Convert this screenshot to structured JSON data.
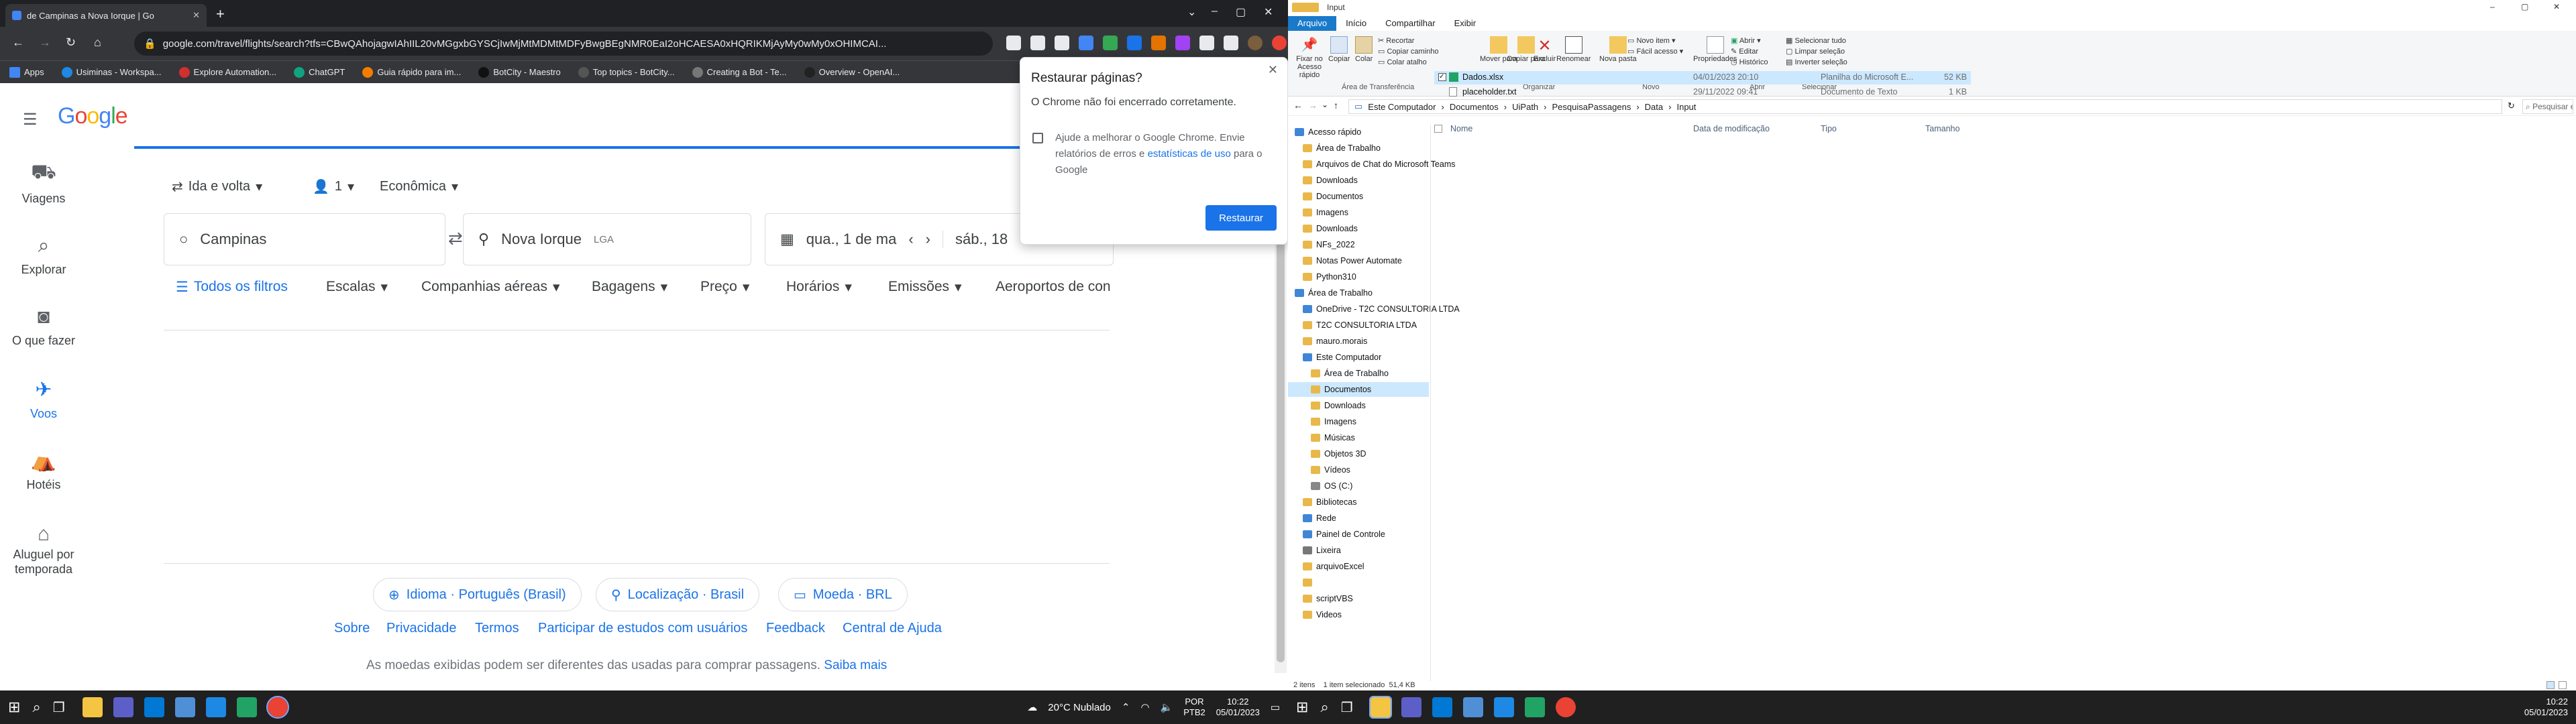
{
  "chrome": {
    "tab_title": "de Campinas a Nova Iorque | Go",
    "url": "google.com/travel/flights/search?tfs=CBwQAhojagwIAhIIL20vMGgxbGYSCjIwMjMtMDMtMDFyBwgBEgNMR0EaI2oHCAESA0xHQRIKMjAyMy0wMy0xOHIMCAI...",
    "bookmarks": [
      "Apps",
      "Usiminas - Workspa...",
      "Explore Automation...",
      "ChatGPT",
      "Guia rápido para im...",
      "BotCity - Maestro",
      "Top topics - BotCity...",
      "Creating a Bot - Te...",
      "Overview - OpenAI..."
    ]
  },
  "flights": {
    "logo": "Google",
    "nav": [
      "Viagens",
      "Explorar",
      "O que fazer",
      "Voos",
      "Hotéis",
      "Aluguel por temporada"
    ],
    "trip_type": "Ida e volta",
    "passengers": "1",
    "cabin": "Econômica",
    "origin": "Campinas",
    "destination": "Nova Iorque",
    "destination_code": "LGA",
    "depart_date": "qua., 1 de ma",
    "return_date": "sáb., 18",
    "filters": [
      "Todos os filtros",
      "Escalas",
      "Companhias aéreas",
      "Bagagens",
      "Preço",
      "Horários",
      "Emissões",
      "Aeroportos de con"
    ],
    "footer_pills": [
      "Idioma · Português (Brasil)",
      "Localização · Brasil",
      "Moeda · BRL"
    ],
    "footer_links": [
      "Sobre",
      "Privacidade",
      "Termos",
      "Participar de estudos com usuários",
      "Feedback",
      "Central de Ajuda"
    ],
    "disclaimer": "As moedas exibidas podem ser diferentes das usadas para comprar passagens.",
    "disclaimer_link": "Saiba mais"
  },
  "dialog": {
    "title": "Restaurar páginas?",
    "message": "O Chrome não foi encerrado corretamente.",
    "checkbox_text": "Ajude a melhorar o Google Chrome. Envie relatórios de erros e",
    "checkbox_link": "estatísticas de uso",
    "checkbox_tail": "para o Google",
    "button": "Restaurar"
  },
  "taskbar_left": {
    "weather": "20°C Nublado",
    "lang": "POR",
    "lang2": "PTB2",
    "time": "10:22",
    "date": "05/01/2023"
  },
  "explorer": {
    "title": "Input",
    "ribbon_tabs": [
      "Arquivo",
      "Início",
      "Compartilhar",
      "Exibir"
    ],
    "ribbon_buttons": [
      "Fixar no Acesso rápido",
      "Copiar",
      "Colar",
      "Recortar",
      "Copiar caminho",
      "Colar atalho",
      "Mover para",
      "Copiar para",
      "Excluir",
      "Renomear",
      "Nova pasta",
      "Novo item",
      "Fácil acesso",
      "Propriedades",
      "Abrir",
      "Editar",
      "Histórico",
      "Selecionar tudo",
      "Limpar seleção",
      "Inverter seleção"
    ],
    "ribbon_groups": [
      "Área de Transferência",
      "Organizar",
      "Novo",
      "Abrir",
      "Selecionar"
    ],
    "breadcrumb": [
      "Este Computador",
      "Documentos",
      "UiPath",
      "PesquisaPassagens",
      "Data",
      "Input"
    ],
    "search_placeholder": "Pesquisar em Input",
    "tree": [
      "Acesso rápido",
      "Área de Trabalho",
      "Arquivos de Chat do Microsoft Teams",
      "Downloads",
      "Documentos",
      "Imagens",
      "Downloads",
      "NFs_2022",
      "Notas Power Automate",
      "Python310",
      "Área de Trabalho",
      "OneDrive - T2C CONSULTORIA LTDA",
      "T2C CONSULTORIA LTDA",
      "mauro.morais",
      "Este Computador",
      "Área de Trabalho",
      "Documentos",
      "Downloads",
      "Imagens",
      "Músicas",
      "Objetos 3D",
      "Vídeos",
      "OS (C:)",
      "Bibliotecas",
      "Rede",
      "Painel de Controle",
      "Lixeira",
      "arquivoExcel",
      "",
      "scriptVBS",
      "Videos"
    ],
    "columns": [
      "Nome",
      "Data de modificação",
      "Tipo",
      "Tamanho"
    ],
    "files": [
      {
        "name": "Dados.xlsx",
        "date": "04/01/2023 20:10",
        "type": "Planilha do Microsoft E...",
        "size": "52 KB"
      },
      {
        "name": "placeholder.txt",
        "date": "29/11/2022 09:41",
        "type": "Documento de Texto",
        "size": "1 KB"
      }
    ],
    "status": "2 itens    1 item selecionado  51,4 KB",
    "time": "10:22",
    "date": "05/01/2023"
  }
}
